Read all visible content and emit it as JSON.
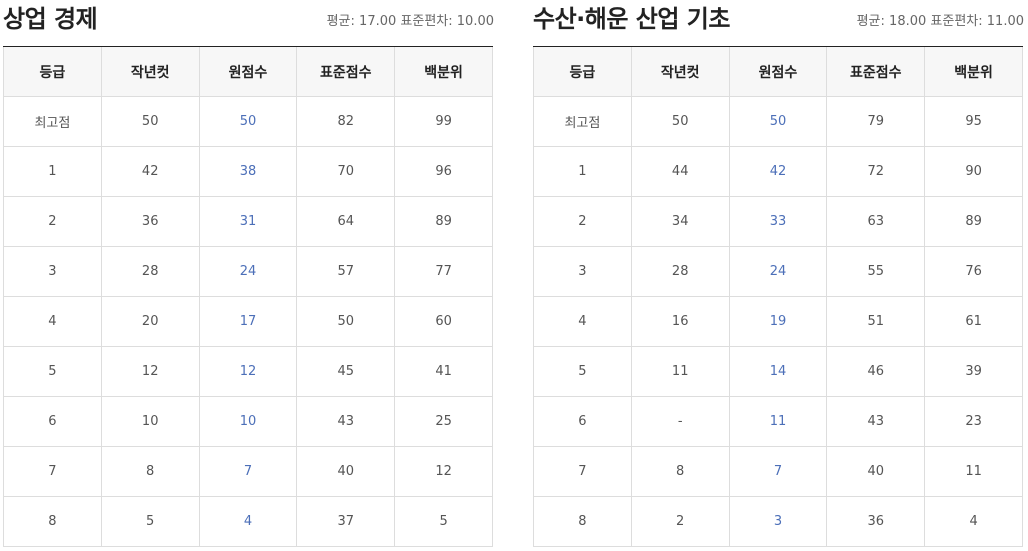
{
  "left": {
    "title": "상업 경제",
    "stats_label_avg": "평균:",
    "stats_avg": "17.00",
    "stats_label_sd": "표준편차:",
    "stats_sd": "10.00",
    "headers": [
      "등급",
      "작년컷",
      "원점수",
      "표준점수",
      "백분위"
    ],
    "rows": [
      [
        "최고점",
        "50",
        "50",
        "82",
        "99"
      ],
      [
        "1",
        "42",
        "38",
        "70",
        "96"
      ],
      [
        "2",
        "36",
        "31",
        "64",
        "89"
      ],
      [
        "3",
        "28",
        "24",
        "57",
        "77"
      ],
      [
        "4",
        "20",
        "17",
        "50",
        "60"
      ],
      [
        "5",
        "12",
        "12",
        "45",
        "41"
      ],
      [
        "6",
        "10",
        "10",
        "43",
        "25"
      ],
      [
        "7",
        "8",
        "7",
        "40",
        "12"
      ],
      [
        "8",
        "5",
        "4",
        "37",
        "5"
      ]
    ]
  },
  "right": {
    "title": "수산·해운 산업 기초",
    "stats_label_avg": "평균:",
    "stats_avg": "18.00",
    "stats_label_sd": "표준편차:",
    "stats_sd": "11.00",
    "headers": [
      "등급",
      "작년컷",
      "원점수",
      "표준점수",
      "백분위"
    ],
    "rows": [
      [
        "최고점",
        "50",
        "50",
        "79",
        "95"
      ],
      [
        "1",
        "44",
        "42",
        "72",
        "90"
      ],
      [
        "2",
        "34",
        "33",
        "63",
        "89"
      ],
      [
        "3",
        "28",
        "24",
        "55",
        "76"
      ],
      [
        "4",
        "16",
        "19",
        "51",
        "61"
      ],
      [
        "5",
        "11",
        "14",
        "46",
        "39"
      ],
      [
        "6",
        "-",
        "11",
        "43",
        "23"
      ],
      [
        "7",
        "8",
        "7",
        "40",
        "11"
      ],
      [
        "8",
        "2",
        "3",
        "36",
        "4"
      ]
    ]
  },
  "colors": {
    "raw_score": "#4c6fb8",
    "header_bg": "#f7f7f7",
    "border": "#dddddd",
    "title": "#222222"
  }
}
